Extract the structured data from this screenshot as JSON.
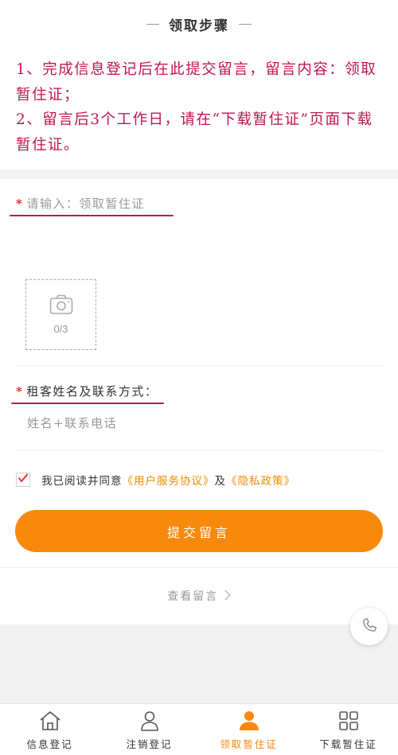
{
  "header": {
    "title": "领取步骤"
  },
  "steps": [
    "1、完成信息登记后在此提交留言，留言内容：领取暂住证；",
    "2、留言后3个工作日，请在“下载暂住证”页面下载暂住证。"
  ],
  "form": {
    "required_mark": "*",
    "message": {
      "placeholder": "请输入：领取暂住证"
    },
    "upload": {
      "count": "0/3"
    },
    "tenant": {
      "label": "租客姓名及联系方式：",
      "placeholder": "姓名+联系电话"
    },
    "agreement": {
      "prefix": "我已阅读并同意",
      "terms": "《用户服务协议》",
      "and": "及",
      "privacy": "《隐私政策》"
    },
    "submit_label": "提交留言",
    "view_link": "查看留言"
  },
  "tabs": [
    {
      "label": "信息登记"
    },
    {
      "label": "注销登记"
    },
    {
      "label": "领取暂住证"
    },
    {
      "label": "下载暂住证"
    }
  ],
  "colors": {
    "accent": "#f7890c",
    "steps_text": "#c0174b",
    "required": "#e6212a"
  }
}
